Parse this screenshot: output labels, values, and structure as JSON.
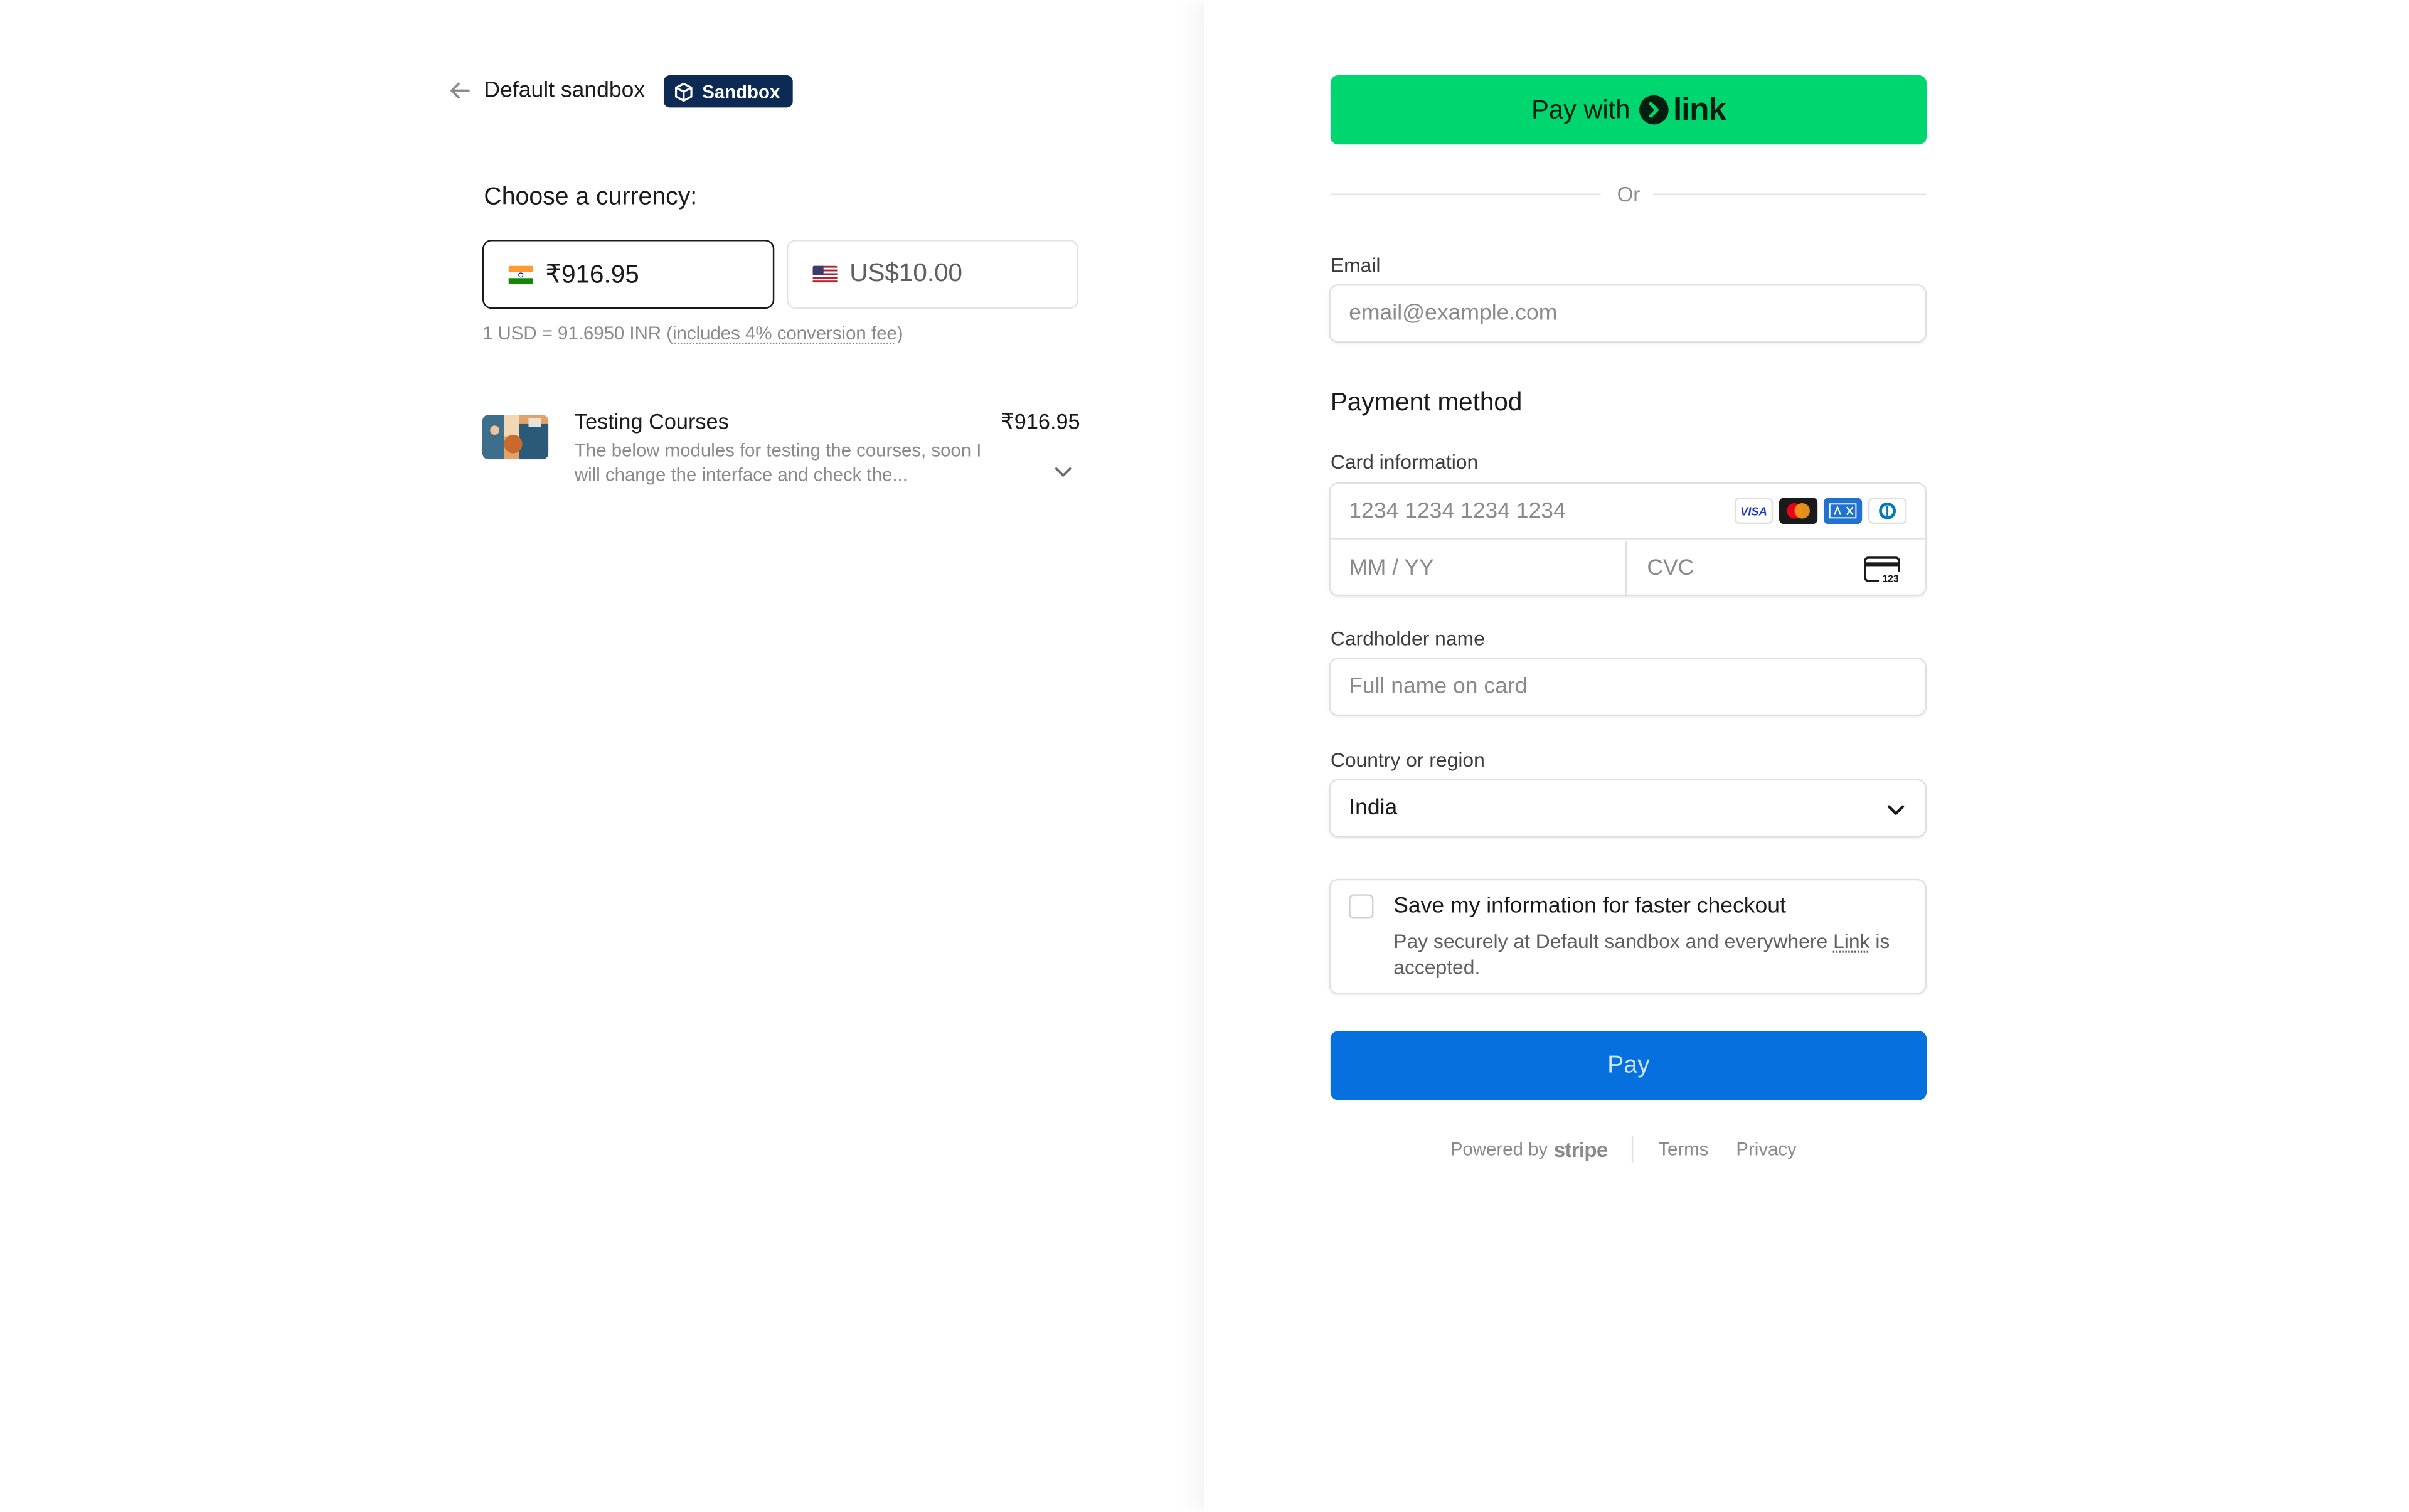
{
  "left": {
    "merchant_name": "Default sandbox",
    "sandbox_badge": "Sandbox",
    "currency_title": "Choose a currency:",
    "currencies": [
      {
        "amount": "₹916.95",
        "flag": "india-flag-icon",
        "selected": true
      },
      {
        "amount": "US$10.00",
        "flag": "us-flag-icon",
        "selected": false
      }
    ],
    "rate_prefix": "1 USD = 91.6950 INR (",
    "rate_fee": "includes 4% conversion fee",
    "rate_suffix": ")",
    "product": {
      "name": "Testing Courses",
      "price": "₹916.95",
      "description_line1": "The below modules for testing the courses, soon I",
      "description_line2": "will change the interface and check the..."
    }
  },
  "right": {
    "link_button": {
      "prefix": "Pay with",
      "brand": "link"
    },
    "divider_text": "Or",
    "email": {
      "label": "Email",
      "placeholder": "email@example.com"
    },
    "payment_method_title": "Payment method",
    "card": {
      "label": "Card information",
      "number_placeholder": "1234 1234 1234 1234",
      "expiry_placeholder": "MM / YY",
      "cvc_placeholder": "CVC",
      "brands": [
        "visa",
        "mastercard",
        "amex",
        "diners"
      ]
    },
    "cardholder": {
      "label": "Cardholder name",
      "placeholder": "Full name on card"
    },
    "country": {
      "label": "Country or region",
      "value": "India"
    },
    "save_info": {
      "title": "Save my information for faster checkout",
      "desc_prefix": "Pay securely at Default sandbox and everywhere ",
      "desc_link": "Link",
      "desc_suffix": " is accepted."
    },
    "pay_button": "Pay",
    "footer": {
      "powered_by": "Powered by",
      "stripe": "stripe",
      "terms": "Terms",
      "privacy": "Privacy"
    }
  },
  "colors": {
    "link_green": "#00d66f",
    "pay_blue": "#0570de",
    "badge_navy": "#0d2a55"
  }
}
